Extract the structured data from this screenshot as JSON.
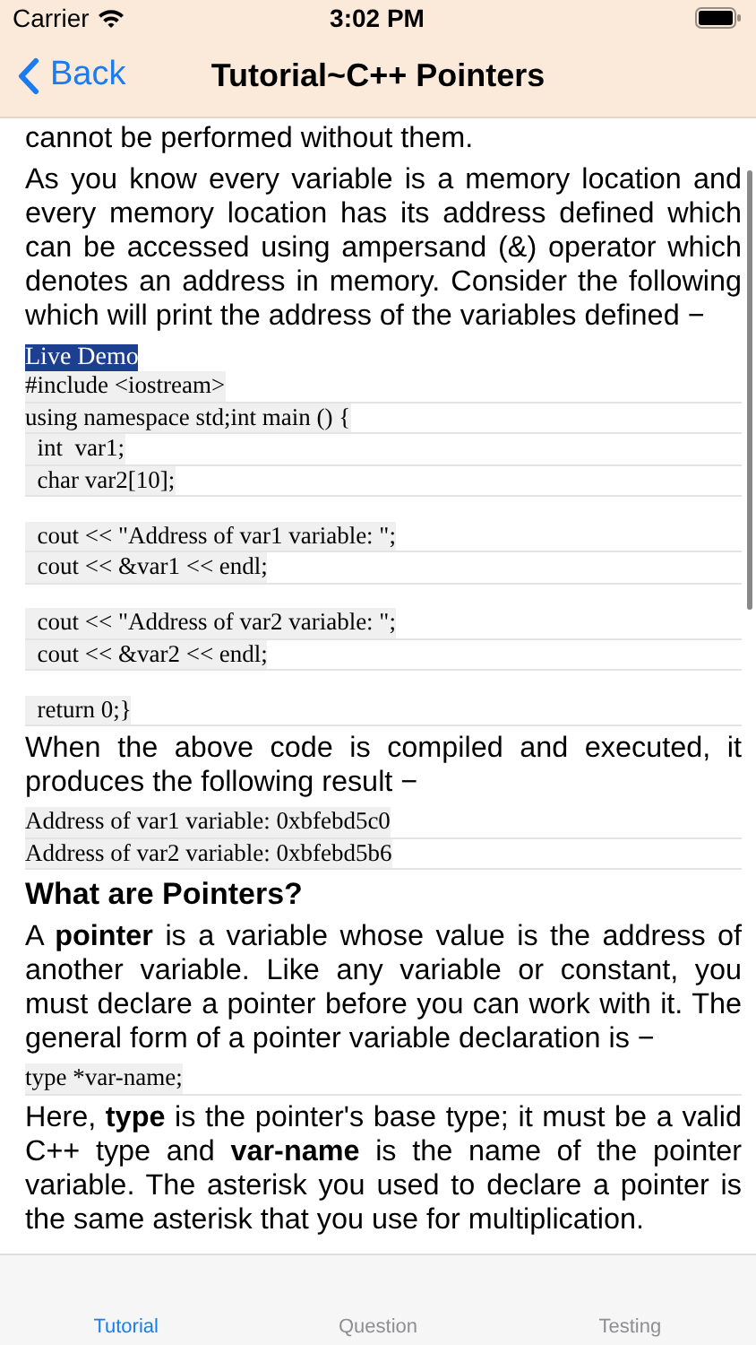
{
  "status_bar": {
    "carrier": "Carrier",
    "time": "3:02 PM"
  },
  "nav_bar": {
    "back": "Back",
    "title": "Tutorial~C++ Pointers"
  },
  "content": [
    {
      "kind": "para",
      "text": "cannot be performed without them."
    },
    {
      "kind": "para",
      "text": "As you know every variable is a memory location and every memory location has its address defined which can be accessed using ampersand (&) operator which denotes an address in memory. Consider the following which will print the address of the variables defined −"
    },
    {
      "kind": "demo",
      "text": "Live Demo"
    },
    {
      "kind": "code",
      "lines": [
        {
          "text": "#include <iostream>",
          "space_before": false
        },
        {
          "text": "using namespace std;int main () {",
          "space_before": false
        },
        {
          "text": "  int  var1;",
          "space_before": false
        },
        {
          "text": "  char var2[10];",
          "space_before": false
        },
        {
          "text": "  cout << \"Address of var1 variable: \";",
          "space_before": true
        },
        {
          "text": "  cout << &var1 << endl;",
          "space_before": false
        },
        {
          "text": "  cout << \"Address of var2 variable: \";",
          "space_before": true
        },
        {
          "text": "  cout << &var2 << endl;",
          "space_before": false
        },
        {
          "text": "  return 0;}",
          "space_before": true
        }
      ]
    },
    {
      "kind": "para",
      "text": "When the above code is compiled and executed, it produces the following result −"
    },
    {
      "kind": "code",
      "lines": [
        {
          "text": "Address of var1 variable: 0xbfebd5c0",
          "space_before": false
        },
        {
          "text": "Address of var2 variable: 0xbfebd5b6",
          "space_before": false
        }
      ]
    },
    {
      "kind": "heading",
      "text": "What are Pointers?"
    },
    {
      "kind": "para",
      "text": "A **pointer** is a variable whose value is the address of another variable. Like any variable or constant, you must declare a pointer before you can work with it. The general form of a pointer variable declaration is −"
    },
    {
      "kind": "code",
      "lines": [
        {
          "text": "type *var-name;",
          "space_before": false
        }
      ]
    },
    {
      "kind": "para",
      "text": "Here, **type** is the pointer's base type; it must be a valid C++ type and **var-name** is the name of the pointer variable. The asterisk you used to declare a pointer is the same asterisk that you use for multiplication."
    }
  ],
  "tab_bar": [
    {
      "label": "Tutorial",
      "selected": true
    },
    {
      "label": "Question",
      "selected": false
    },
    {
      "label": "Testing",
      "selected": false
    }
  ]
}
